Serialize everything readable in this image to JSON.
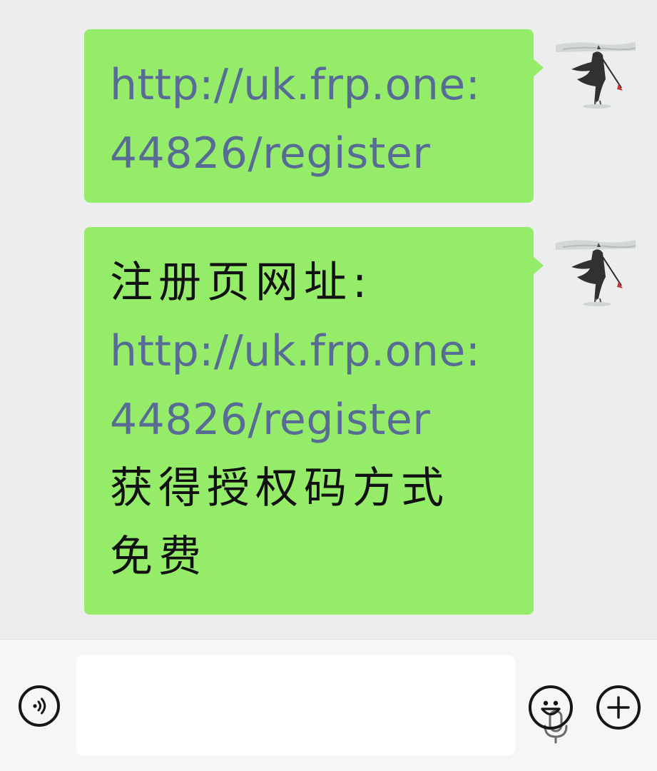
{
  "messages": [
    {
      "lines": [
        {
          "text": "http://uk.frp.one:",
          "type": "link"
        },
        {
          "text": "44826/register",
          "type": "link"
        }
      ]
    },
    {
      "lines": [
        {
          "text": "注册页网址:",
          "type": "plain"
        },
        {
          "text": "http://uk.frp.one:",
          "type": "link"
        },
        {
          "text": "44826/register",
          "type": "link"
        },
        {
          "text": "获得授权码方式",
          "type": "plain"
        },
        {
          "text": "免费",
          "type": "plain"
        }
      ]
    }
  ],
  "icons": {
    "voice_toggle": "voice-icon",
    "mic": "microphone-icon",
    "emoji": "emoji-icon",
    "more": "plus-icon"
  },
  "colors": {
    "bubble": "#95ec69",
    "link": "#576b95",
    "chat_bg": "#ededed",
    "input_bar_bg": "#f6f6f6"
  }
}
